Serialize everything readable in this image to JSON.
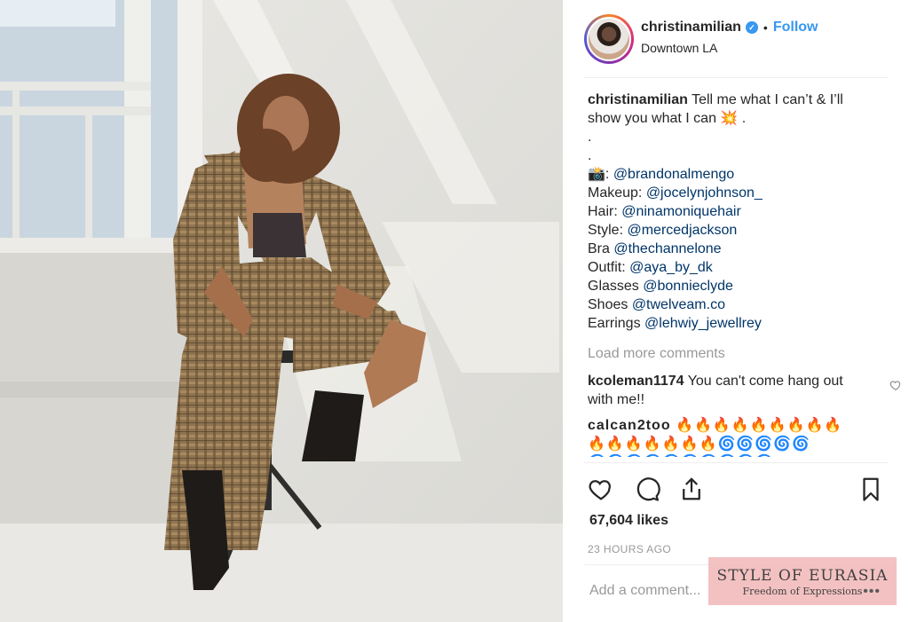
{
  "post": {
    "username": "christinamilian",
    "verified_mark": "✓",
    "separator": "•",
    "follow_label": "Follow",
    "location": "Downtown LA"
  },
  "caption": {
    "username": "christinamilian",
    "text": "Tell me what I can’t & I’ll",
    "text_line2": "show you what I can",
    "line2_emoji": "💥",
    "line2_tail": ".",
    "dot1": ".",
    "dot2": ".",
    "credits": [
      {
        "label": "📸: ",
        "mention": "@brandonalmengo"
      },
      {
        "label": "Makeup: ",
        "mention": "@jocelynjohnson_"
      },
      {
        "label": "Hair: ",
        "mention": "@ninamoniquehair"
      },
      {
        "label": "Style: ",
        "mention": "@mercedjackson"
      },
      {
        "label": "Bra ",
        "mention": "@thechannelone"
      },
      {
        "label": "Outfit: ",
        "mention": "@aya_by_dk"
      },
      {
        "label": "Glasses ",
        "mention": "@bonnieclyde"
      },
      {
        "label": "Shoes ",
        "mention": "@twelveam.co"
      },
      {
        "label": "Earrings ",
        "mention": "@lehwiy_jewellrey"
      }
    ]
  },
  "load_more_label": "Load more comments",
  "comments": [
    {
      "username": "kcoleman1174",
      "text": "You can't come hang out",
      "text_line2": "with me!!"
    },
    {
      "username": "calcan2too",
      "emoji_line1": "🔥🔥🔥🔥🔥🔥🔥🔥🔥",
      "emoji_line2": "🔥🔥🔥🔥🔥🔥🔥🌀🌀🌀🌀🌀",
      "emoji_line3": "🌀🌀🌀🌀🌀🌀🌀🌀🌀🌀"
    }
  ],
  "likes_label": "67,604 likes",
  "timestamp": "23 HOURS AGO",
  "add_comment_placeholder": "Add a comment...",
  "watermark": {
    "title": "STYLE OF EURASIA",
    "subtitle": "Freedom of Expressions",
    "more": "•••"
  },
  "colors": {
    "link": "#003569",
    "follow": "#3897f0",
    "muted": "#999999",
    "watermark_bg": "#f3c0c0"
  },
  "icons": [
    "verified-badge-icon",
    "heart-icon",
    "comment-icon",
    "share-icon",
    "bookmark-icon",
    "heart-small-icon"
  ]
}
